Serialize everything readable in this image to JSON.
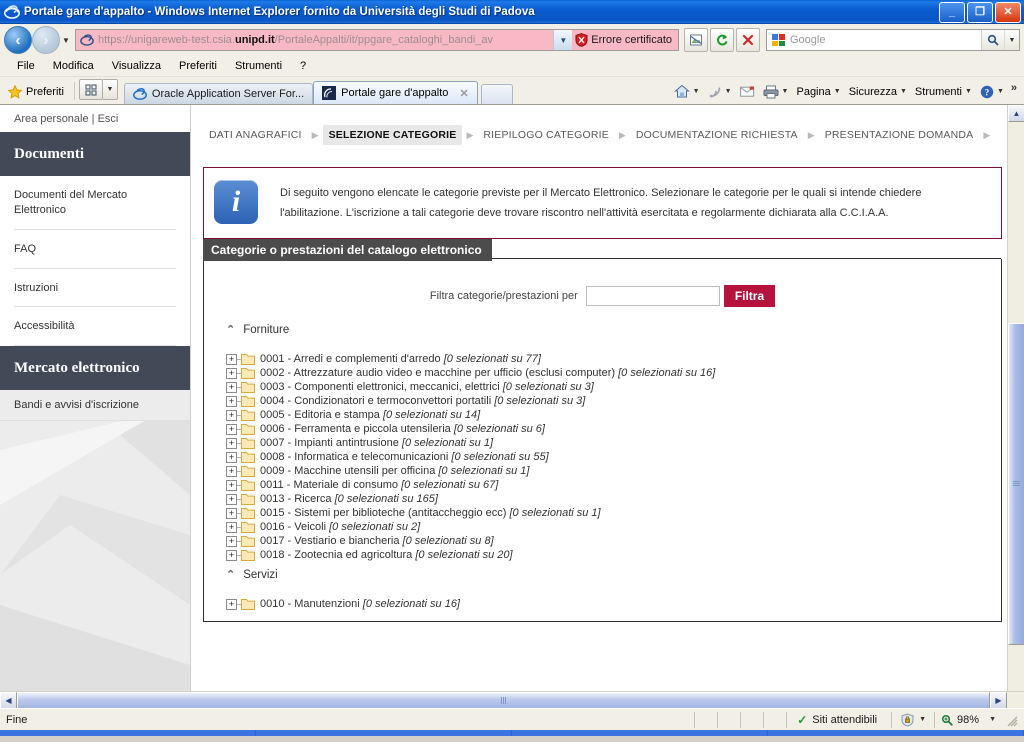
{
  "window": {
    "title": "Portale gare d'appalto - Windows Internet Explorer fornito da Università degli Studi di Padova",
    "minimize_label": "_",
    "restore_label": "❐",
    "close_label": "✕"
  },
  "navbar": {
    "back_label": "‹",
    "forward_label": "›",
    "history_caret": "▼",
    "url_prefix": "https://unigareweb-test.csia.",
    "url_domain": "unipd.it",
    "url_suffix": "/PortaleAppalti/it/ppgare_cataloghi_bandi_av",
    "address_caret": "▼",
    "cert_error_label": "Errore certificato",
    "compat_title": "Visualizzazione compatibilità",
    "refresh_label": "↻",
    "stop_label": "✕",
    "search_placeholder": "Google",
    "search_go_label": "🔍",
    "search_caret": "▼"
  },
  "menubar": {
    "items": [
      {
        "label": "File"
      },
      {
        "label": "Modifica"
      },
      {
        "label": "Visualizza"
      },
      {
        "label": "Preferiti"
      },
      {
        "label": "Strumenti"
      },
      {
        "label": "?"
      }
    ]
  },
  "favbar": {
    "favorites_label": "Preferiti",
    "grid_caret": "▼",
    "tabs": [
      {
        "label": "Oracle Application Server For...",
        "active": false
      },
      {
        "label": "Portale gare d'appalto",
        "active": true,
        "close_label": "✕"
      }
    ],
    "commands": [
      {
        "name": "home",
        "label": "",
        "caret": "▼"
      },
      {
        "name": "feeds",
        "label": "",
        "caret": "▼"
      },
      {
        "name": "read-mail",
        "label": "",
        "caret": ""
      },
      {
        "name": "print",
        "label": "",
        "caret": "▼"
      },
      {
        "name": "page",
        "label": "Pagina",
        "caret": "▼"
      },
      {
        "name": "safety",
        "label": "Sicurezza",
        "caret": "▼"
      },
      {
        "name": "tools",
        "label": "Strumenti",
        "caret": "▼"
      },
      {
        "name": "help",
        "label": "",
        "caret": "▼"
      }
    ],
    "overflow_label": "»"
  },
  "sidebar": {
    "account_area": "Area personale",
    "account_sep": "|",
    "account_logout": "Esci",
    "sections": [
      {
        "heading": "Documenti",
        "items": [
          {
            "label": "Documenti del Mercato Elettronico"
          },
          {
            "label": "FAQ"
          },
          {
            "label": "Istruzioni"
          },
          {
            "label": "Accessibilità"
          }
        ]
      }
    ],
    "second_heading": "Mercato elettronico",
    "second_item": "Bandi e avvisi d'iscrizione"
  },
  "steps": {
    "arrow": "▶",
    "items": [
      {
        "label": "DATI ANAGRAFICI",
        "active": false
      },
      {
        "label": "SELEZIONE CATEGORIE",
        "active": true
      },
      {
        "label": "RIEPILOGO CATEGORIE",
        "active": false
      },
      {
        "label": "DOCUMENTAZIONE RICHIESTA",
        "active": false
      },
      {
        "label": "PRESENTAZIONE DOMANDA",
        "active": false
      }
    ]
  },
  "info": {
    "icon_glyph": "i",
    "text": "Di seguito vengono elencate le categorie previste per il Mercato Elettronico. Selezionare le categorie per le quali si intende chiedere l'abilitazione. L'iscrizione a tali categorie deve trovare riscontro nell'attività esercitata e regolarmente dichiarata alla C.C.I.A.A."
  },
  "panel": {
    "title": "Categorie o prestazioni del catalogo elettronico",
    "filter_label": "Filtra categorie/prestazioni per",
    "filter_value": "",
    "filter_placeholder": "",
    "filter_button": "Filtra",
    "expander_glyph": "+",
    "group_chevron": "⌃",
    "groups": [
      {
        "name": "Forniture",
        "items": [
          {
            "code": "0001",
            "label": "Arredi e complementi d'arredo",
            "count": "[0 selezionati su 77]"
          },
          {
            "code": "0002",
            "label": "Attrezzature audio video e macchine per ufficio (esclusi computer)",
            "count": "[0 selezionati su 16]"
          },
          {
            "code": "0003",
            "label": "Componenti elettronici, meccanici, elettrici",
            "count": "[0 selezionati su 3]"
          },
          {
            "code": "0004",
            "label": "Condizionatori e termoconvettori portatili",
            "count": "[0 selezionati su 3]"
          },
          {
            "code": "0005",
            "label": "Editoria e stampa",
            "count": "[0 selezionati su 14]"
          },
          {
            "code": "0006",
            "label": "Ferramenta e piccola utensileria",
            "count": "[0 selezionati su 6]"
          },
          {
            "code": "0007",
            "label": "Impianti antintrusione",
            "count": "[0 selezionati su 1]"
          },
          {
            "code": "0008",
            "label": "Informatica e telecomunicazioni",
            "count": "[0 selezionati su 55]"
          },
          {
            "code": "0009",
            "label": "Macchine utensili per officina",
            "count": "[0 selezionati su 1]"
          },
          {
            "code": "0011",
            "label": "Materiale di consumo",
            "count": "[0 selezionati su 67]"
          },
          {
            "code": "0013",
            "label": "Ricerca",
            "count": "[0 selezionati su 165]"
          },
          {
            "code": "0015",
            "label": "Sistemi per biblioteche (antitaccheggio ecc)",
            "count": "[0 selezionati su 1]"
          },
          {
            "code": "0016",
            "label": "Veicoli",
            "count": "[0 selezionati su 2]"
          },
          {
            "code": "0017",
            "label": "Vestiario e biancheria",
            "count": "[0 selezionati su 8]"
          },
          {
            "code": "0018",
            "label": "Zootecnia ed agricoltura",
            "count": "[0 selezionati su 20]"
          }
        ]
      },
      {
        "name": "Servizi",
        "items": [
          {
            "code": "0010",
            "label": "Manutenzioni",
            "count": "[0 selezionati su 16]"
          }
        ]
      }
    ]
  },
  "scrollbars": {
    "up_label": "▲",
    "down_label": "▼",
    "left_label": "◀",
    "right_label": "▶"
  },
  "statusbar": {
    "status_text": "Fine",
    "zone_check": "✓",
    "zone_label": "Siti attendibili",
    "protected_caret": "▼",
    "zoom_label": "98%",
    "zoom_caret": "▼"
  },
  "colors": {
    "accent_crimson": "#b5123e",
    "sidebar_header": "#414a56",
    "panel_header": "#4c4c4c",
    "info_border": "#7c1030",
    "title_blue": "#0a5ccf"
  }
}
